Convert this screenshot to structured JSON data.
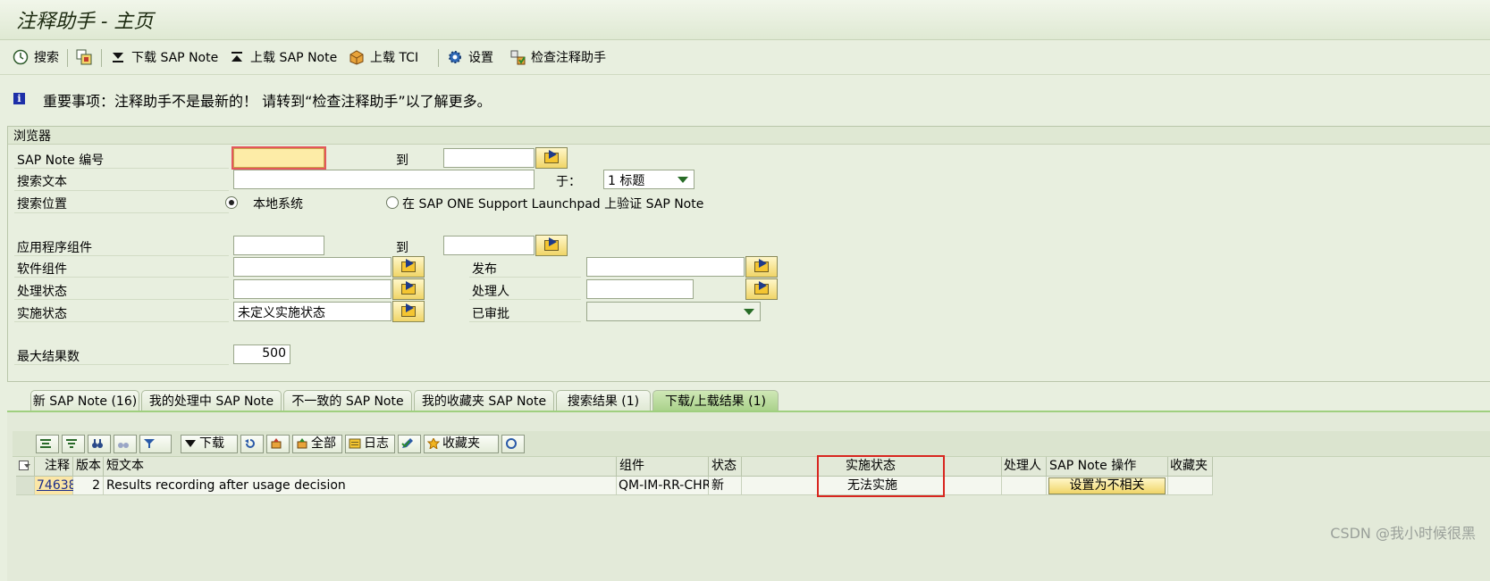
{
  "window": {
    "title": "注释助手 - 主页"
  },
  "toolbar": {
    "search": "搜索",
    "download": "下载 SAP Note",
    "upload": "上载 SAP Note",
    "upload_tci": "上载 TCI",
    "settings": "设置",
    "check": "检查注释助手"
  },
  "message": {
    "text": "重要事项：注释助手不是最新的！ 请转到“检查注释助手”以了解更多。"
  },
  "browser": {
    "label": "浏览器",
    "sap_note_no": "SAP Note 编号",
    "to": "到",
    "search_text": "搜索文本",
    "in": "于：",
    "in_value": "1 标题",
    "search_location": "搜索位置",
    "local_system": "本地系统",
    "launchpad": "在 SAP ONE Support Launchpad 上验证 SAP Note",
    "app_component": "应用程序组件",
    "to2": "到",
    "software_component": "软件组件",
    "release": "发布",
    "processing_status": "处理状态",
    "processor": "处理人",
    "impl_status": "实施状态",
    "impl_status_value": "未定义实施状态",
    "approved": "已审批",
    "max_results": "最大结果数",
    "max_results_value": "500"
  },
  "tabs": [
    {
      "label": "新 SAP Note (16)"
    },
    {
      "label": "我的处理中 SAP Note"
    },
    {
      "label": "不一致的 SAP Note"
    },
    {
      "label": "我的收藏夹 SAP Note"
    },
    {
      "label": "搜索结果 (1)"
    },
    {
      "label": "下载/上载结果 (1)",
      "active": true
    }
  ],
  "alv_toolbar": {
    "download": "下载",
    "all": "全部",
    "log": "日志",
    "favorites": "收藏夹"
  },
  "table": {
    "headers": {
      "note": "注释",
      "version": "版本",
      "short_text": "短文本",
      "component": "组件",
      "status": "状态",
      "impl_status": "实施状态",
      "processor": "处理人",
      "note_action": "SAP Note 操作",
      "favorites": "收藏夹"
    },
    "rows": [
      {
        "note": "74638",
        "version": "2",
        "short_text": "Results recording after usage decision",
        "component": "QM-IM-RR-CHR",
        "status": "新",
        "impl_status": "无法实施",
        "processor": "",
        "action": "设置为不相关",
        "favorites": ""
      }
    ]
  },
  "watermark": "CSDN @我小时候很黑"
}
